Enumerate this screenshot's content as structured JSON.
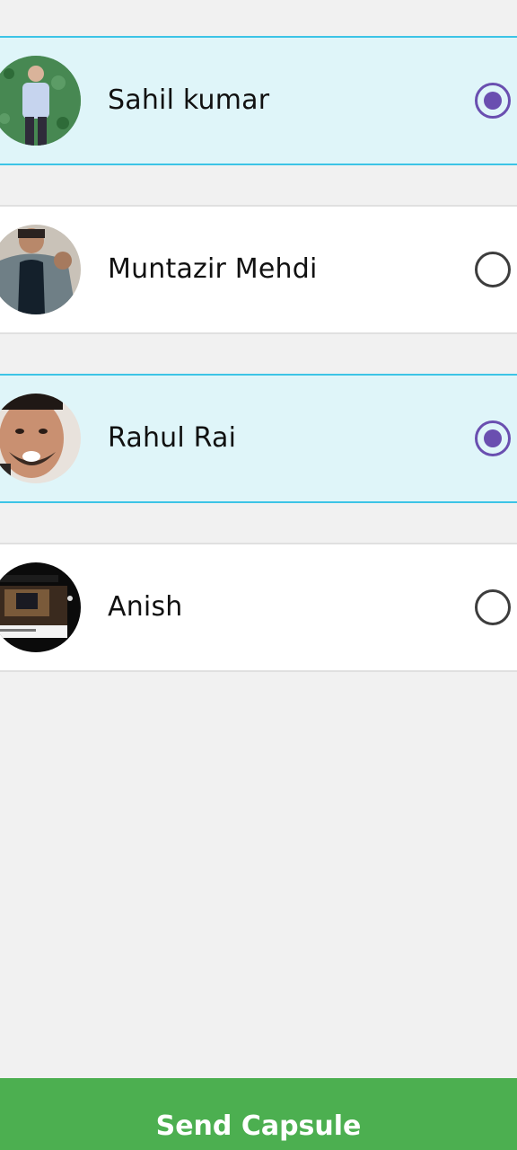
{
  "contacts": [
    {
      "name": "Sahil kumar",
      "selected": true,
      "avatar": "person-standing-green-wall-photo"
    },
    {
      "name": "Muntazir Mehdi",
      "selected": false,
      "avatar": "person-leather-jacket-photo"
    },
    {
      "name": "Rahul Rai",
      "selected": true,
      "avatar": "person-face-closeup-photo"
    },
    {
      "name": "Anish",
      "selected": false,
      "avatar": "laptop-desk-screenshot-photo"
    }
  ],
  "send_button": {
    "label": "Send Capsule"
  },
  "colors": {
    "page_background": "#f1f1f1",
    "selected_row_background": "#dff5f9",
    "selected_row_border": "#3cc4e6",
    "radio_checked": "#6a4fb0",
    "radio_unchecked": "#3d3d3d",
    "send_bar": "#4caf50"
  }
}
